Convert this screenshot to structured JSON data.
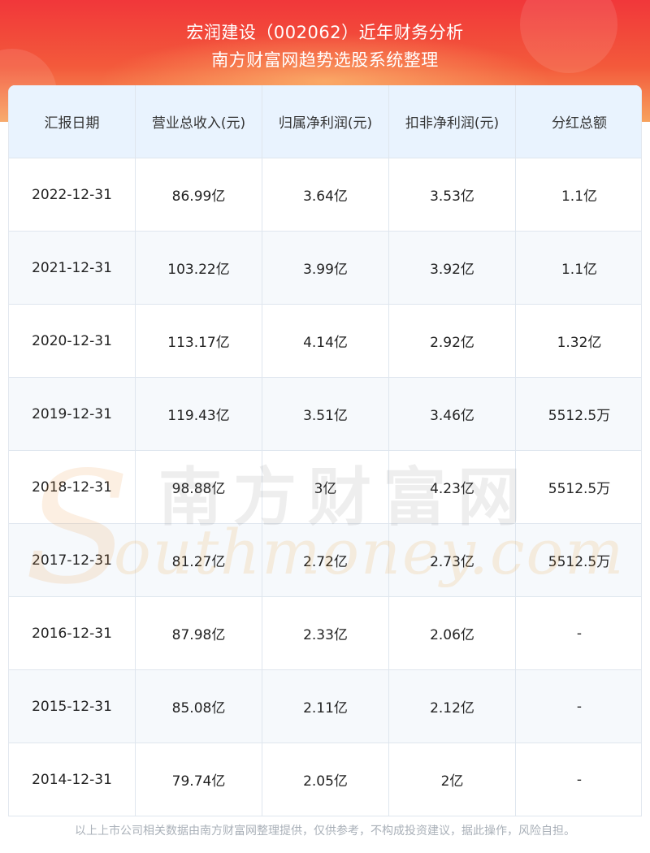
{
  "header": {
    "title_line1": "宏润建设（002062）近年财务分析",
    "title_line2": "南方财富网趋势选股系统整理"
  },
  "table": {
    "columns": [
      "汇报日期",
      "营业总收入(元)",
      "归属净利润(元)",
      "扣非净利润(元)",
      "分红总额"
    ],
    "rows": [
      [
        "2022-12-31",
        "86.99亿",
        "3.64亿",
        "3.53亿",
        "1.1亿"
      ],
      [
        "2021-12-31",
        "103.22亿",
        "3.99亿",
        "3.92亿",
        "1.1亿"
      ],
      [
        "2020-12-31",
        "113.17亿",
        "4.14亿",
        "2.92亿",
        "1.32亿"
      ],
      [
        "2019-12-31",
        "119.43亿",
        "3.51亿",
        "3.46亿",
        "5512.5万"
      ],
      [
        "2018-12-31",
        "98.88亿",
        "3亿",
        "4.23亿",
        "5512.5万"
      ],
      [
        "2017-12-31",
        "81.27亿",
        "2.72亿",
        "2.73亿",
        "5512.5万"
      ],
      [
        "2016-12-31",
        "87.98亿",
        "2.33亿",
        "2.06亿",
        "-"
      ],
      [
        "2015-12-31",
        "85.08亿",
        "2.11亿",
        "2.12亿",
        "-"
      ],
      [
        "2014-12-31",
        "79.74亿",
        "2.05亿",
        "2亿",
        "-"
      ]
    ]
  },
  "watermark": {
    "chinese": "南方财富网",
    "english": "outhmoney.com",
    "logo_letter": "S"
  },
  "footer": {
    "disclaimer": "以上上市公司相关数据由南方财富网整理提供，仅供参考，不构成投资建议，据此操作，风险自担。"
  },
  "colors": {
    "banner_top": "#f1373a",
    "banner_bottom": "#f7a25e",
    "header_row": "#e9f3fe",
    "alt_row": "#f6f9fc",
    "border": "#dfe6ee"
  }
}
